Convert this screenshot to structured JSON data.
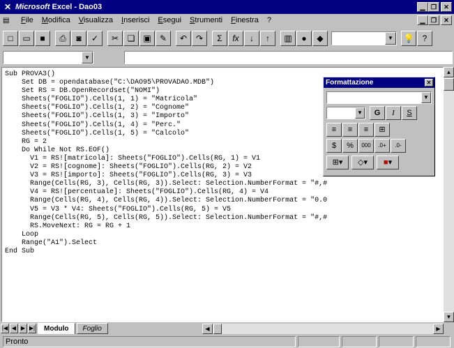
{
  "window": {
    "app_name": "Microsoft",
    "title_rest": " Excel - Dao03"
  },
  "menu": [
    "File",
    "Modifica",
    "Visualizza",
    "Inserisci",
    "Esegui",
    "Strumenti",
    "Finestra",
    "?"
  ],
  "toolbar": {
    "buttons": [
      "new-icon",
      "open-icon",
      "save-icon",
      "print-icon",
      "print-preview-icon",
      "spelling-icon",
      "cut-icon",
      "copy-icon",
      "paste-icon",
      "format-painter-icon",
      "undo-icon",
      "redo-icon",
      "autosum-icon",
      "function-wizard-icon",
      "sort-ascending-icon",
      "sort-descending-icon",
      "chart-wizard-icon",
      "map-icon",
      "drawing-icon",
      "tipwizard-icon",
      "help-icon"
    ],
    "zoom_value": ""
  },
  "code": {
    "lines": [
      "Sub PROVA3()",
      "    Set DB = opendatabase(\"C:\\DAO95\\PROVADAO.MDB\")",
      "    Set RS = DB.OpenRecordset(\"NOMI\")",
      "    Sheets(\"FOGLIO\").Cells(1, 1) = \"Matricola\"",
      "    Sheets(\"FOGLIO\").Cells(1, 2) = \"Cognome\"",
      "    Sheets(\"FOGLIO\").Cells(1, 3) = \"Importo\"",
      "    Sheets(\"FOGLIO\").Cells(1, 4) = \"Perc.\"",
      "    Sheets(\"FOGLIO\").Cells(1, 5) = \"Calcolo\"",
      "    RG = 2",
      "    Do While Not RS.EOF()",
      "      V1 = RS![matricola]: Sheets(\"FOGLIO\").Cells(RG, 1) = V1",
      "      V2 = RS![cognome]: Sheets(\"FOGLIO\").Cells(RG, 2) = V2",
      "      V3 = RS![importo]: Sheets(\"FOGLIO\").Cells(RG, 3) = V3",
      "      Range(Cells(RG, 3), Cells(RG, 3)).Select: Selection.NumberFormat = \"#,#",
      "      V4 = RS![percentuale]: Sheets(\"FOGLIO\").Cells(RG, 4) = V4",
      "      Range(Cells(RG, 4), Cells(RG, 4)).Select: Selection.NumberFormat = \"0.0",
      "      V5 = V3 * V4: Sheets(\"FOGLIO\").Cells(RG, 5) = V5",
      "      Range(Cells(RG, 5), Cells(RG, 5)).Select: Selection.NumberFormat = \"#,#",
      "      RS.MoveNext: RG = RG + 1",
      "    Loop",
      "    Range(\"A1\").Select",
      "End Sub"
    ]
  },
  "palette": {
    "title": "Formattazione",
    "bold": "G",
    "italic": "I",
    "underline": "S"
  },
  "sheets": {
    "active": "Modulo",
    "other": "Foglio"
  },
  "status": {
    "text": "Pronto"
  }
}
